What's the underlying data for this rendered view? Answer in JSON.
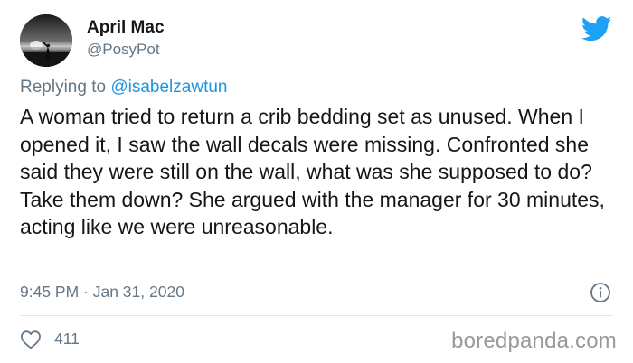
{
  "author": {
    "name": "April Mac",
    "handle": "@PosyPot"
  },
  "reply": {
    "prefix": "Replying to",
    "mention": "@isabelzawtun"
  },
  "tweet": {
    "text": "A woman tried to return a crib bedding set as unused. When I opened it, I saw the wall decals were missing. Confronted she said they were still on the wall, what was she supposed to do? Take them down? She argued with the manager for 30 minutes, acting like we were unreasonable.",
    "timestamp": "9:45 PM · Jan 31, 2020"
  },
  "engagement": {
    "likes": "411"
  },
  "watermark": "boredpanda.com",
  "icons": {
    "brand": "twitter-bird-icon",
    "info": "info-icon",
    "like": "heart-icon"
  },
  "colors": {
    "twitter_blue": "#1da1f2",
    "mention_blue": "#1b95e0",
    "text": "#14171a",
    "muted": "#657786",
    "divider": "#e1e8ed",
    "watermark": "#999999"
  }
}
